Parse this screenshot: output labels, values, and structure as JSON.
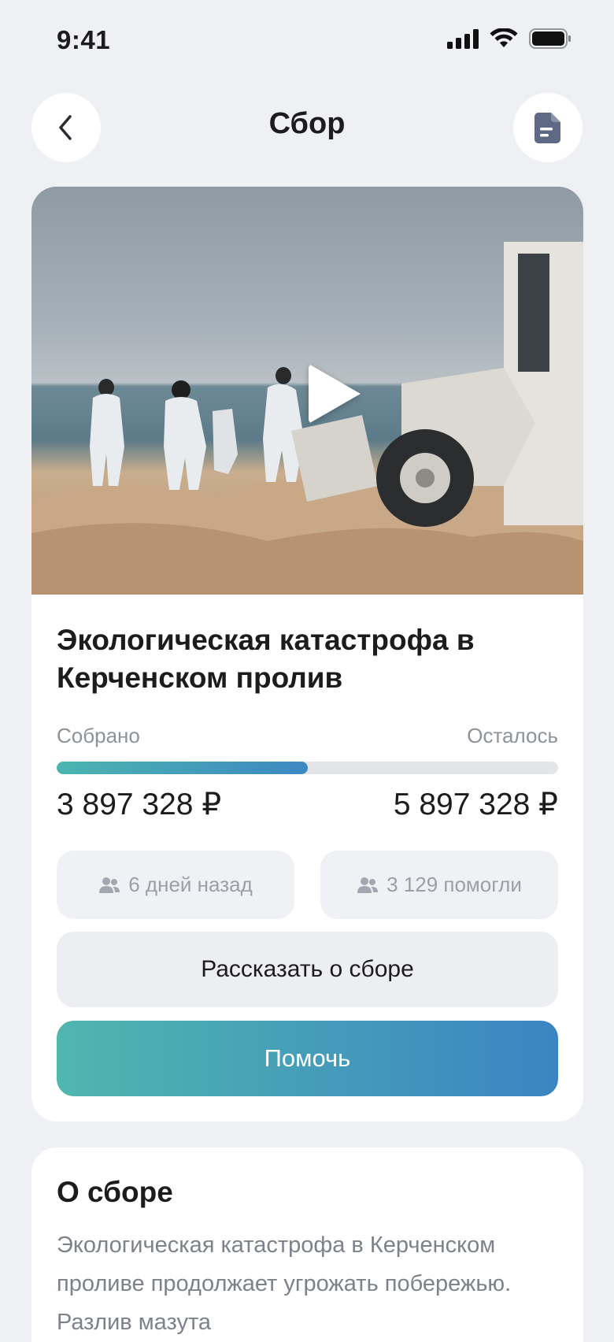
{
  "status_bar": {
    "time": "9:41"
  },
  "header": {
    "title": "Сбор"
  },
  "fund": {
    "title": "Экологическая катастрофа в Керченском пролив",
    "collected_label": "Собрано",
    "left_label": "Осталось",
    "collected_amount": "3 897 328 ₽",
    "left_amount": "5 897 328 ₽",
    "progress_fraction": 0.5,
    "created_ago": "6 дней назад",
    "helpers": "3 129 помогли",
    "share_button": "Рассказать о сборе",
    "help_button": "Помочь"
  },
  "about": {
    "title": "О сборе",
    "text": "Экологическая катастрофа в Керченском проливе продолжает угрожать побережью. Разлив мазута"
  },
  "colors": {
    "background": "#eef0f3",
    "accent_start": "#4fb7ae",
    "accent_end": "#3b84c3"
  },
  "icons": {
    "back": "chevron-left-icon",
    "document": "document-icon",
    "play": "play-icon",
    "users": "users-icon"
  }
}
